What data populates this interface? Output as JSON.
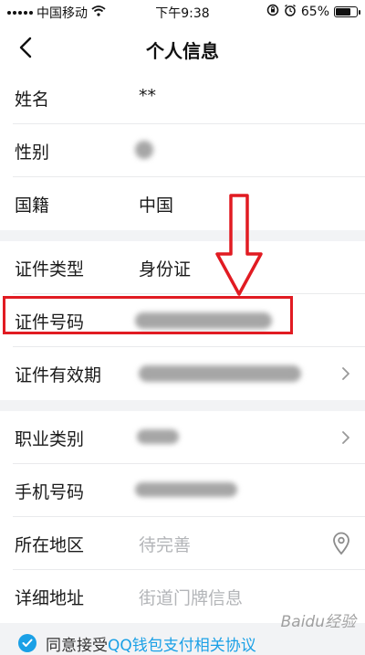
{
  "status_bar": {
    "carrier": "中国移动",
    "time": "下午9:38",
    "battery": "65%",
    "battery_level": 0.65,
    "icons": [
      "signal-icon",
      "wifi-icon",
      "rotation-lock-icon",
      "alarm-icon",
      "battery-icon"
    ]
  },
  "nav": {
    "title": "个人信息",
    "back_icon": "chevron-left-icon"
  },
  "groups": [
    {
      "rows": [
        {
          "label": "姓名",
          "value": "**"
        },
        {
          "label": "性别",
          "value": "",
          "redacted": true
        },
        {
          "label": "国籍",
          "value": "中国"
        }
      ]
    },
    {
      "rows": [
        {
          "label": "证件类型",
          "value": "身份证"
        },
        {
          "label": "证件号码",
          "value": "",
          "redacted": true,
          "highlighted": true
        },
        {
          "label": "证件有效期",
          "value": "",
          "redacted": true,
          "icon": "chevron-right-icon"
        }
      ]
    },
    {
      "rows": [
        {
          "label": "职业类别",
          "value": "",
          "redacted": true,
          "icon": "chevron-right-icon"
        },
        {
          "label": "手机号码",
          "value": "",
          "redacted": true
        },
        {
          "label": "所在地区",
          "placeholder": "待完善",
          "icon": "location-pin-icon"
        },
        {
          "label": "详细地址",
          "placeholder": "街道门牌信息"
        }
      ]
    }
  ],
  "agreement": {
    "prefix": "同意接受",
    "link": "QQ钱包支付相关协议"
  },
  "watermark": "Baidu经验",
  "colors": {
    "accent": "#1aa0e6",
    "annotation_red": "#e11b22",
    "background": "#f2f3f5"
  }
}
